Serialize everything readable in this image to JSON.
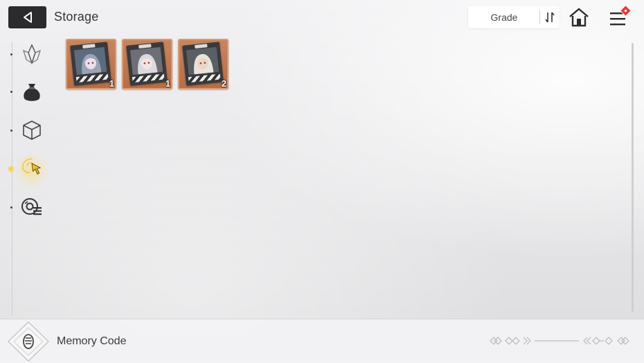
{
  "header": {
    "title": "Storage",
    "sort_label": "Grade"
  },
  "sidebar": {
    "items": [
      {
        "icon": "crystal-icon",
        "active": false
      },
      {
        "icon": "pouch-icon",
        "active": false
      },
      {
        "icon": "cube-icon",
        "active": false
      },
      {
        "icon": "memory-swirl-icon",
        "active": true
      },
      {
        "icon": "disc-list-icon",
        "active": false
      }
    ]
  },
  "items": [
    {
      "name": "memory-film-1",
      "count": "1",
      "colors": {
        "bg": "#5c6b7e",
        "face": "#e9e2ea",
        "hair": "#9aa3b4"
      }
    },
    {
      "name": "memory-film-2",
      "count": "1",
      "colors": {
        "bg": "#6e6f76",
        "face": "#f1e6e3",
        "hair": "#d9d9de"
      }
    },
    {
      "name": "memory-film-3",
      "count": "2",
      "colors": {
        "bg": "#5a5f66",
        "face": "#e7d7c8",
        "hair": "#e9e4da"
      }
    }
  ],
  "footer": {
    "label": "Memory Code"
  },
  "colors": {
    "item_bg": "#b66d45",
    "active_accent": "#f2c94c",
    "notification": "#e23a3a"
  }
}
